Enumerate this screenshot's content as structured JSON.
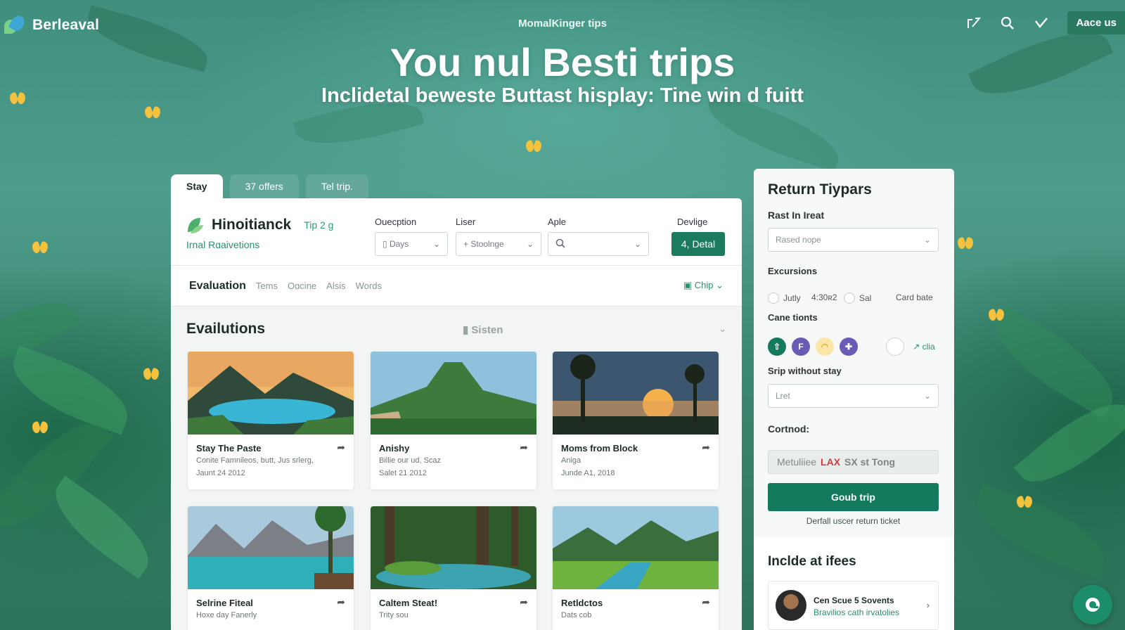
{
  "nav": {
    "brand": "Berleaval",
    "center_link": "MomalKinger tips",
    "contact_label": "Aace us",
    "icons": [
      "edit-icon",
      "search-icon",
      "check-icon"
    ]
  },
  "hero": {
    "title": "You nul Besti trips",
    "subtitle": "Inclidetal beweste Buttast hisplay: Tine win d fuitt"
  },
  "tabs": [
    "Stay",
    "37 offers",
    "Tel trip."
  ],
  "panel": {
    "brand_name": "Hinoitianck",
    "brand_tip": "Tip 2 g",
    "brand_sub": "Irnal Rɑaivetions",
    "filters": [
      {
        "label": "Ouecption",
        "value": "Days"
      },
      {
        "label": "Liser",
        "value": "Stoolnge"
      },
      {
        "label": "Aple",
        "value": ""
      }
    ],
    "devlige_label": "Devlige",
    "detail_button": "4, Detal",
    "subnav": {
      "main": "Evaluation",
      "items": [
        "Tems",
        "Oɑcine",
        "Alsis",
        "Words"
      ],
      "chip": "Chip"
    },
    "section_title": "Evailutions",
    "section_mid": "Sisten",
    "cards": [
      {
        "title": "Stay The Paste",
        "line1": "Conite Famnileos, butt, Jus srlerg,",
        "line2": "Jaunt 24 2012",
        "image": "lake-mountain-sunset"
      },
      {
        "title": "Anishy",
        "line1": "Billie our ud, Scaz",
        "line2": "Salet 21 2012",
        "image": "green-volcano"
      },
      {
        "title": "Moms from Block",
        "line1": "Aniga",
        "line2": "Junde A1, 2018",
        "image": "palm-sunset"
      },
      {
        "title": "Selrine Fiteal",
        "line1": "Hoxe day Fanerly",
        "line2": "",
        "image": "alpine-lake"
      },
      {
        "title": "Caltem Steat!",
        "line1": "Trity sou",
        "line2": "",
        "image": "forest-stream"
      },
      {
        "title": "Retldctos",
        "line1": "Dats cob",
        "line2": "",
        "image": "valley-river"
      }
    ]
  },
  "sidebar": {
    "title": "Return Tiypars",
    "rast_label": "Rast In Ireat",
    "rast_placeholder": "Rased nope",
    "excursions_label": "Excursions",
    "radios": [
      "Jutly",
      "Sal"
    ],
    "radio_time": "4:30ʀ2",
    "card_date": "Card bate",
    "cane_label": "Cane tionts",
    "cane_icons": [
      {
        "glyph": "⇧",
        "color": "#137a5d"
      },
      {
        "glyph": "F",
        "color": "#6a5bb5"
      },
      {
        "glyph": "◠",
        "color": "#f2c23f"
      },
      {
        "glyph": "✚",
        "color": "#6a5bb5"
      }
    ],
    "cane_link": "↗ clia",
    "srip_label": "Srip without stay",
    "srip_value": "Lret",
    "cortnod_label": "Cortnod:",
    "cortnod_prefix": "Metuliiee",
    "cortnod_red": "LAX",
    "cortnod_rest": "SX st Tong",
    "go_button": "Goub trip",
    "note": "Derfall uscer return ticket",
    "include_title": "Inclde at ifees",
    "person_name": "Cen Scue 5 Sovents",
    "person_sub": "Bravilios cath irvatolies"
  }
}
